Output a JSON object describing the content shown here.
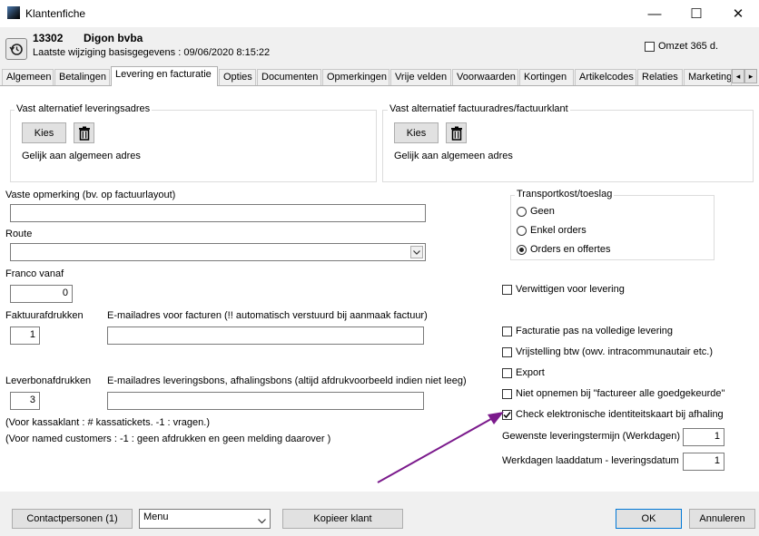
{
  "window": {
    "title": "Klantenfiche",
    "minimize": "—",
    "maximize": "☐",
    "close": "✕"
  },
  "header": {
    "customer_number": "13302",
    "customer_name": "Digon bvba",
    "last_modified": "Laatste wijziging basisgegevens  : 09/06/2020 8:15:22",
    "turnover_label": "Omzet 365 d."
  },
  "tabs": [
    "Algemeen",
    "Betalingen",
    "Levering en facturatie",
    "Opties",
    "Documenten",
    "Opmerkingen",
    "Vrije velden",
    "Voorwaarden",
    "Kortingen",
    "Artikelcodes",
    "Relaties",
    "Marketing"
  ],
  "tab_scroll": {
    "left": "◂",
    "right": "▸"
  },
  "delivery_address": {
    "title": "Vast alternatief leveringsadres",
    "choose": "Kies",
    "text": "Gelijk aan algemeen adres"
  },
  "invoice_address": {
    "title": "Vast alternatief factuuradres/factuurklant",
    "choose": "Kies",
    "text": "Gelijk aan algemeen adres"
  },
  "fixed_remark": {
    "label": "Vaste opmerking (bv. op factuurlayout)",
    "value": ""
  },
  "route": {
    "label": "Route",
    "value": ""
  },
  "franco": {
    "label": "Franco vanaf",
    "value": "0"
  },
  "invoice_prints": {
    "label": "Faktuurafdrukken",
    "value": "1"
  },
  "invoice_email": {
    "label": "E-mailadres voor facturen (!! automatisch verstuurd bij aanmaak factuur)",
    "value": ""
  },
  "delivery_prints": {
    "label": "Leverbonafdrukken",
    "value": "3"
  },
  "delivery_email": {
    "label": "E-mailadres leveringsbons, afhalingsbons (altijd afdrukvoorbeeld indien niet leeg)",
    "value": ""
  },
  "notes": {
    "line1": "(Voor kassaklant : # kassatickets. -1 : vragen.)",
    "line2": "(Voor named customers : -1 : geen afdrukken en geen melding daarover )"
  },
  "transport": {
    "title": "Transportkost/toeslag",
    "options": [
      {
        "label": "Geen",
        "selected": false
      },
      {
        "label": "Enkel orders",
        "selected": false
      },
      {
        "label": "Orders en offertes",
        "selected": true
      }
    ]
  },
  "checkboxes": {
    "notify": {
      "label": "Verwittigen voor levering",
      "checked": false
    },
    "invoice_after_full": {
      "label": "Facturatie pas na volledige levering",
      "checked": false
    },
    "vat_exempt": {
      "label": "Vrijstelling btw (owv. intracommunautair etc.)",
      "checked": false
    },
    "export": {
      "label": "Export",
      "checked": false
    },
    "exclude_invoice_all": {
      "label": "Niet opnemen bij \"factureer alle goedgekeurde\"",
      "checked": false
    },
    "check_id": {
      "label": "Check elektronische identiteitskaart bij afhaling",
      "checked": true
    }
  },
  "desired_term": {
    "label": "Gewenste leveringstermijn (Werkdagen)",
    "value": "1"
  },
  "loading_days": {
    "label": "Werkdagen laaddatum - leveringsdatum",
    "value": "1"
  },
  "footer": {
    "contacts": "Contactpersonen (1)",
    "menu": "Menu",
    "copy": "Kopieer klant",
    "ok": "OK",
    "cancel": "Annuleren"
  },
  "colors": {
    "arrow": "#7b1a8c",
    "ok_border": "#0078d7",
    "tab_active_bg": "#ffffff"
  }
}
